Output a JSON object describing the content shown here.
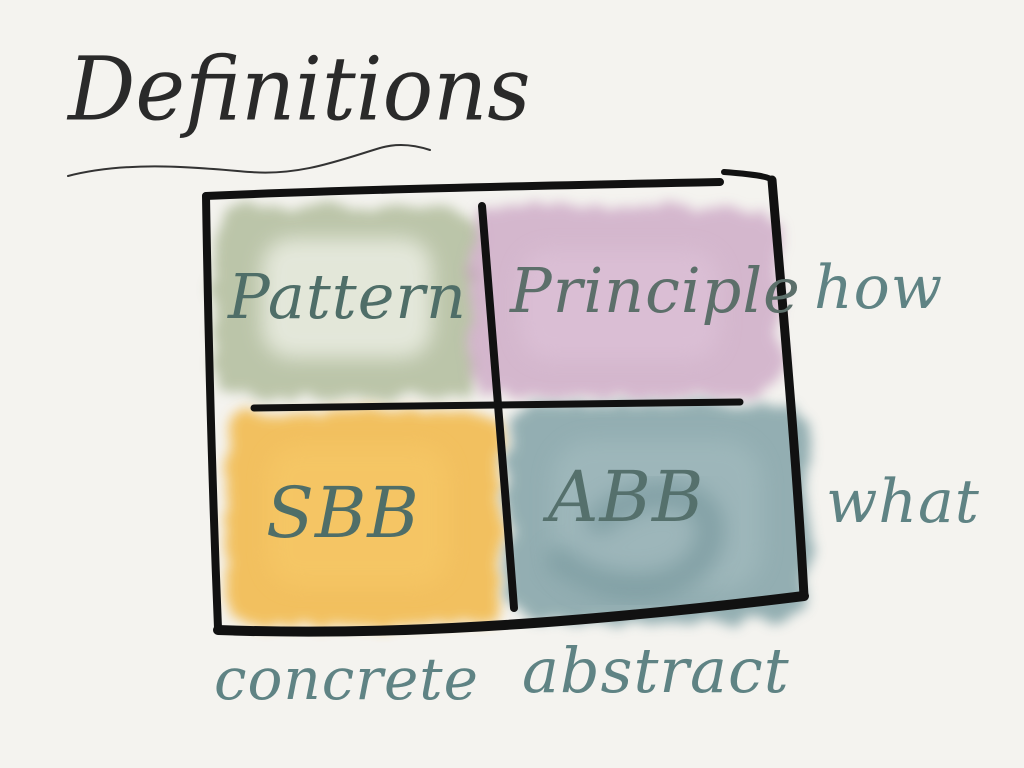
{
  "title": "Definitions",
  "quadrants": {
    "top_left": {
      "label": "Pattern",
      "color": "#a9b692"
    },
    "top_right": {
      "label": "Principle",
      "color": "#c79ec0"
    },
    "bottom_left": {
      "label": "SBB",
      "color": "#f2b847"
    },
    "bottom_right": {
      "label": "ABB",
      "color": "#7c9ea3"
    }
  },
  "row_labels": {
    "top": "how",
    "bottom": "what"
  },
  "column_labels": {
    "left": "concrete",
    "right": "abstract"
  },
  "colors": {
    "background": "#f4f3ef",
    "ink": "#111111",
    "label_ink": "#4f6e68",
    "axis_ink": "#5f8384"
  }
}
